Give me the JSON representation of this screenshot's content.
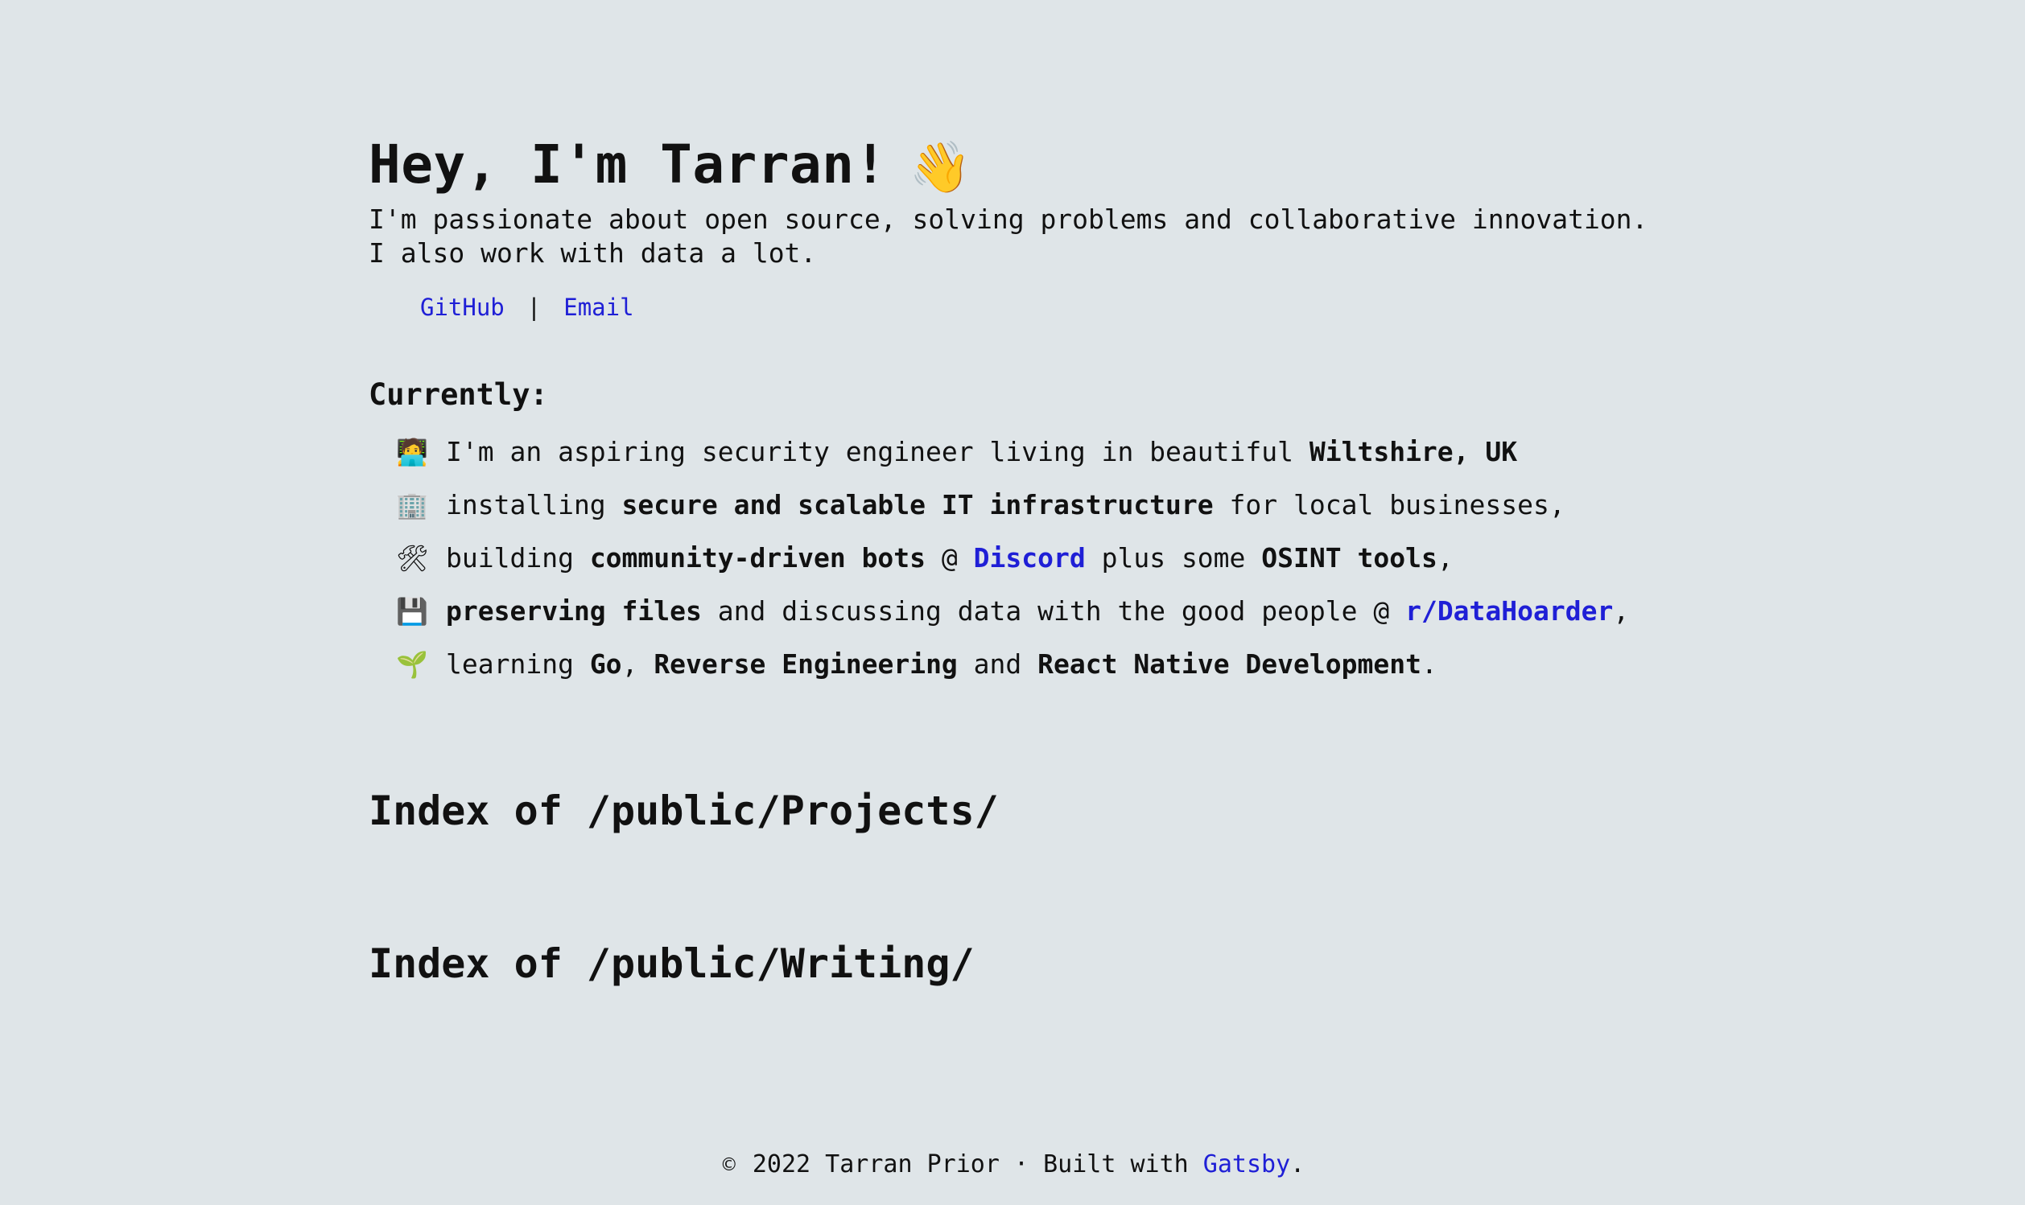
{
  "hero": {
    "title": "Hey, I'm Tarran!",
    "wave_emoji": "👋",
    "intro": "I'm passionate about open source, solving problems and collaborative innovation. I also work with data a lot."
  },
  "links": {
    "github": "GitHub",
    "separator": "|",
    "email": "Email"
  },
  "currently": {
    "title": "Currently:",
    "items": [
      {
        "emoji": "🧑‍💻",
        "icon": "technologist-icon",
        "parts": {
          "t1": "I'm an aspiring security engineer living in beautiful ",
          "b1": "Wiltshire, UK"
        }
      },
      {
        "emoji": "🏢",
        "icon": "office-building-icon",
        "parts": {
          "t1": "installing ",
          "b1": "secure and scalable IT infrastructure",
          "t2": " for local businesses,"
        }
      },
      {
        "emoji": "🛠",
        "icon": "tools-icon",
        "parts": {
          "t1": "building ",
          "b1": "community-driven bots",
          "t2": " @ ",
          "l1": "Discord",
          "t3": " plus some ",
          "b2": "OSINT tools",
          "t4": ","
        }
      },
      {
        "emoji": "💾",
        "icon": "floppy-disk-icon",
        "parts": {
          "b1": "preserving files",
          "t1": " and discussing data with the good people @ ",
          "l1": "r/DataHoarder",
          "t2": ","
        }
      },
      {
        "emoji": "🌱",
        "icon": "seedling-icon",
        "parts": {
          "t1": "learning ",
          "b1": "Go",
          "t2": ", ",
          "b2": "Reverse Engineering",
          "t3": " and ",
          "b3": "React Native Development",
          "t4": "."
        }
      }
    ]
  },
  "indexes": {
    "projects": "Index of /public/Projects/",
    "writing": "Index of /public/Writing/"
  },
  "footer": {
    "copyright_symbol": "©",
    "text": " 2022 Tarran Prior · Built with ",
    "link": "Gatsby",
    "end": "."
  },
  "colors": {
    "background": "#dfe5e8",
    "link": "#1f1fd6",
    "text": "#111111"
  }
}
